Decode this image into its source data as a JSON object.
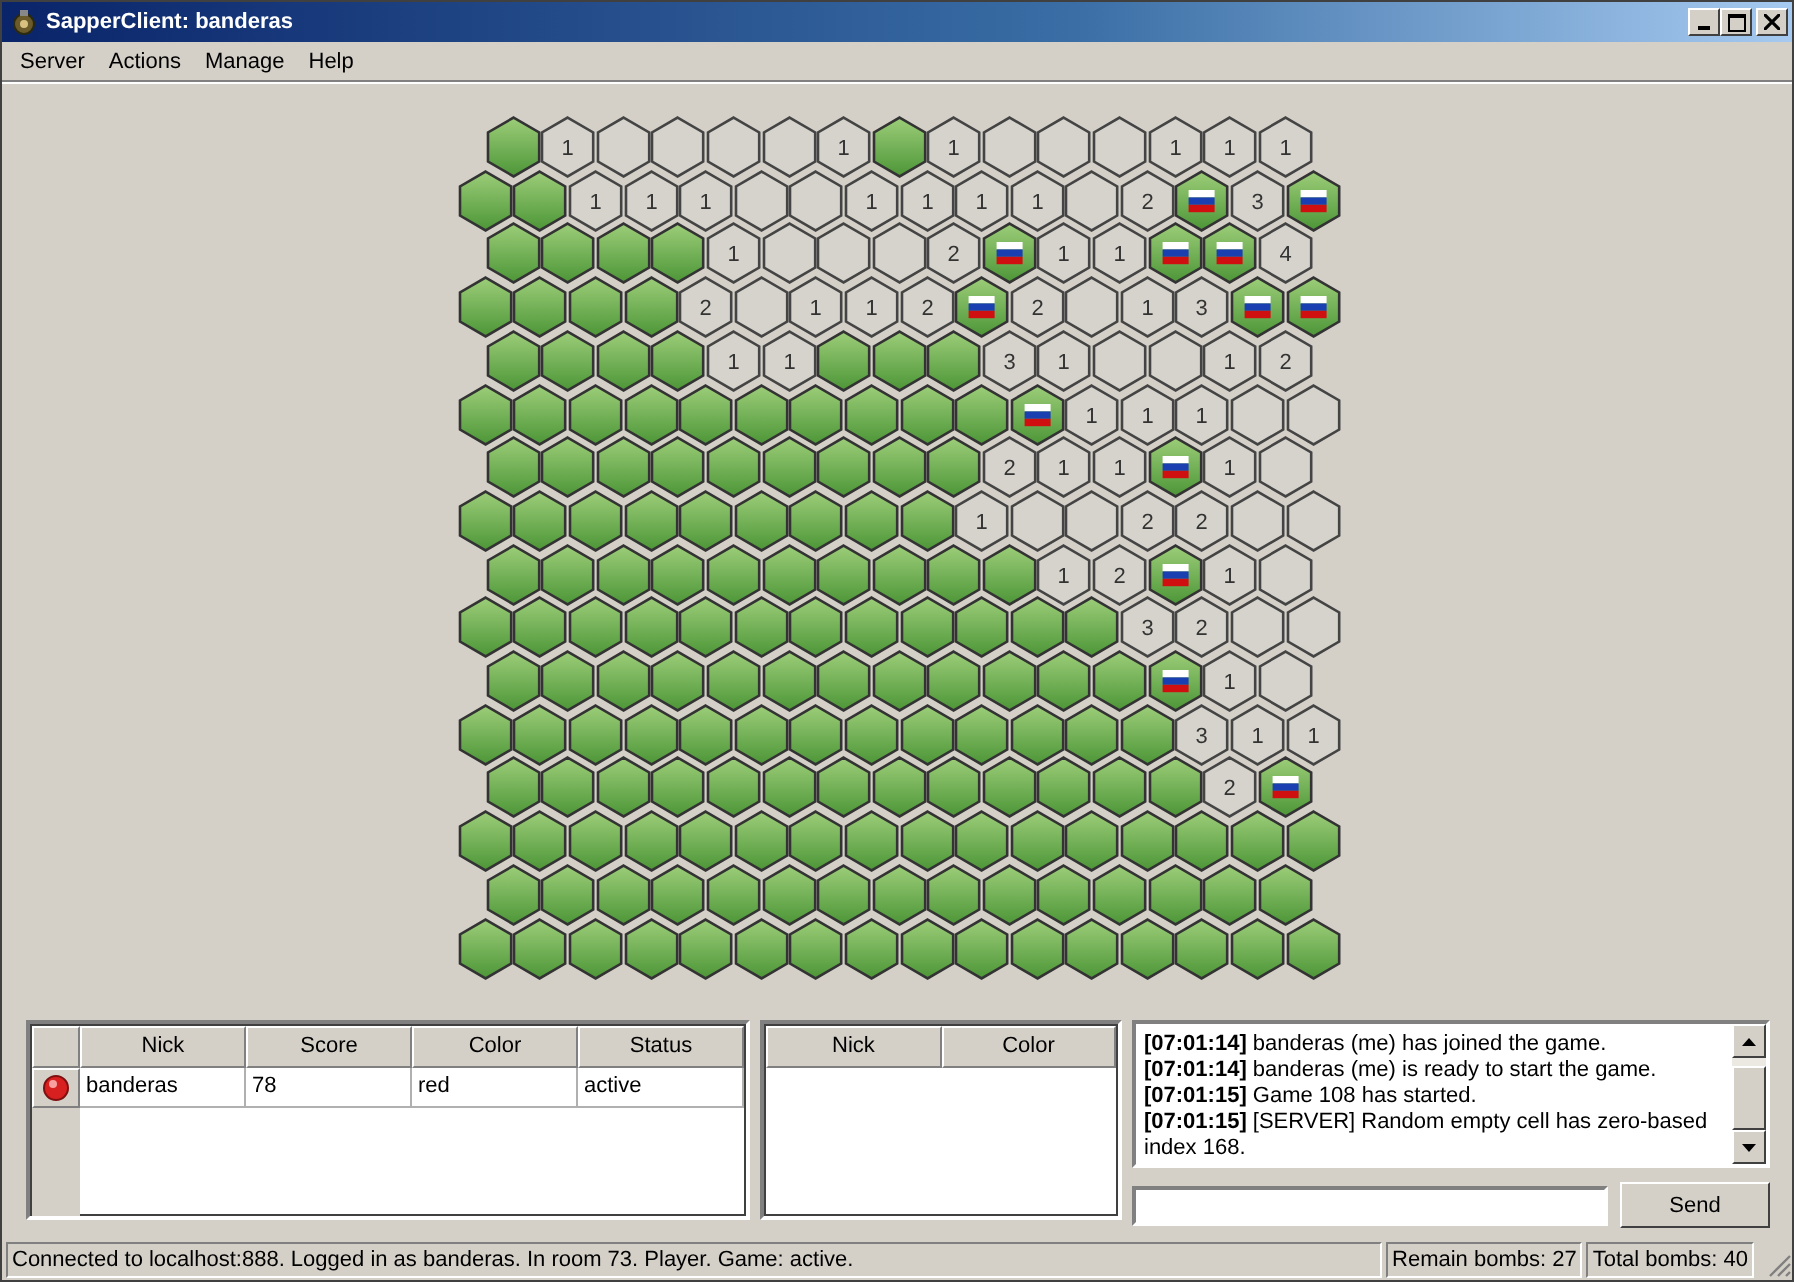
{
  "window": {
    "title": "SapperClient: banderas"
  },
  "menu": [
    "Server",
    "Actions",
    "Manage",
    "Help"
  ],
  "board": {
    "rows": [
      {
        "cells": [
          {
            "kind": "covered"
          },
          {
            "kind": "open",
            "count": "1"
          },
          {
            "kind": "open"
          },
          {
            "kind": "open"
          },
          {
            "kind": "open"
          },
          {
            "kind": "open"
          },
          {
            "kind": "open",
            "count": "1"
          },
          {
            "kind": "covered"
          },
          {
            "kind": "open",
            "count": "1"
          },
          {
            "kind": "open"
          },
          {
            "kind": "open"
          },
          {
            "kind": "open"
          },
          {
            "kind": "open",
            "count": "1"
          },
          {
            "kind": "open",
            "count": "1"
          },
          {
            "kind": "open",
            "count": "1"
          }
        ]
      },
      {
        "cells": [
          {
            "kind": "covered"
          },
          {
            "kind": "covered"
          },
          {
            "kind": "open",
            "count": "1"
          },
          {
            "kind": "open",
            "count": "1"
          },
          {
            "kind": "open",
            "count": "1"
          },
          {
            "kind": "open"
          },
          {
            "kind": "open"
          },
          {
            "kind": "open",
            "count": "1"
          },
          {
            "kind": "open",
            "count": "1"
          },
          {
            "kind": "open",
            "count": "1"
          },
          {
            "kind": "open",
            "count": "1"
          },
          {
            "kind": "open"
          },
          {
            "kind": "open",
            "count": "2"
          },
          {
            "kind": "flagged"
          },
          {
            "kind": "open",
            "count": "3"
          },
          {
            "kind": "flagged"
          }
        ]
      },
      {
        "cells": [
          {
            "kind": "covered"
          },
          {
            "kind": "covered"
          },
          {
            "kind": "covered"
          },
          {
            "kind": "covered"
          },
          {
            "kind": "open",
            "count": "1"
          },
          {
            "kind": "open"
          },
          {
            "kind": "open"
          },
          {
            "kind": "open"
          },
          {
            "kind": "open",
            "count": "2"
          },
          {
            "kind": "flagged"
          },
          {
            "kind": "open",
            "count": "1"
          },
          {
            "kind": "open",
            "count": "1"
          },
          {
            "kind": "flagged"
          },
          {
            "kind": "flagged"
          },
          {
            "kind": "open",
            "count": "4"
          }
        ]
      },
      {
        "cells": [
          {
            "kind": "covered"
          },
          {
            "kind": "covered"
          },
          {
            "kind": "covered"
          },
          {
            "kind": "covered"
          },
          {
            "kind": "open",
            "count": "2"
          },
          {
            "kind": "open"
          },
          {
            "kind": "open",
            "count": "1"
          },
          {
            "kind": "open",
            "count": "1"
          },
          {
            "kind": "open",
            "count": "2"
          },
          {
            "kind": "flagged"
          },
          {
            "kind": "open",
            "count": "2"
          },
          {
            "kind": "open"
          },
          {
            "kind": "open",
            "count": "1"
          },
          {
            "kind": "open",
            "count": "3"
          },
          {
            "kind": "flagged"
          },
          {
            "kind": "flagged"
          }
        ]
      },
      {
        "cells": [
          {
            "kind": "covered"
          },
          {
            "kind": "covered"
          },
          {
            "kind": "covered"
          },
          {
            "kind": "covered"
          },
          {
            "kind": "open",
            "count": "1"
          },
          {
            "kind": "open",
            "count": "1"
          },
          {
            "kind": "covered"
          },
          {
            "kind": "covered"
          },
          {
            "kind": "covered"
          },
          {
            "kind": "open",
            "count": "3"
          },
          {
            "kind": "open",
            "count": "1"
          },
          {
            "kind": "open"
          },
          {
            "kind": "open"
          },
          {
            "kind": "open",
            "count": "1"
          },
          {
            "kind": "open",
            "count": "2"
          }
        ]
      },
      {
        "cells": [
          {
            "kind": "covered"
          },
          {
            "kind": "covered"
          },
          {
            "kind": "covered"
          },
          {
            "kind": "covered"
          },
          {
            "kind": "covered"
          },
          {
            "kind": "covered"
          },
          {
            "kind": "covered"
          },
          {
            "kind": "covered"
          },
          {
            "kind": "covered"
          },
          {
            "kind": "covered"
          },
          {
            "kind": "flagged"
          },
          {
            "kind": "open",
            "count": "1"
          },
          {
            "kind": "open",
            "count": "1"
          },
          {
            "kind": "open",
            "count": "1"
          },
          {
            "kind": "open"
          },
          {
            "kind": "open"
          }
        ]
      },
      {
        "cells": [
          {
            "kind": "covered"
          },
          {
            "kind": "covered"
          },
          {
            "kind": "covered"
          },
          {
            "kind": "covered"
          },
          {
            "kind": "covered"
          },
          {
            "kind": "covered"
          },
          {
            "kind": "covered"
          },
          {
            "kind": "covered"
          },
          {
            "kind": "covered"
          },
          {
            "kind": "open",
            "count": "2"
          },
          {
            "kind": "open",
            "count": "1"
          },
          {
            "kind": "open",
            "count": "1"
          },
          {
            "kind": "flagged"
          },
          {
            "kind": "open",
            "count": "1"
          },
          {
            "kind": "open"
          }
        ]
      },
      {
        "cells": [
          {
            "kind": "covered"
          },
          {
            "kind": "covered"
          },
          {
            "kind": "covered"
          },
          {
            "kind": "covered"
          },
          {
            "kind": "covered"
          },
          {
            "kind": "covered"
          },
          {
            "kind": "covered"
          },
          {
            "kind": "covered"
          },
          {
            "kind": "covered"
          },
          {
            "kind": "open",
            "count": "1"
          },
          {
            "kind": "open"
          },
          {
            "kind": "open"
          },
          {
            "kind": "open",
            "count": "2"
          },
          {
            "kind": "open",
            "count": "2"
          },
          {
            "kind": "open"
          },
          {
            "kind": "open"
          }
        ]
      },
      {
        "cells": [
          {
            "kind": "covered"
          },
          {
            "kind": "covered"
          },
          {
            "kind": "covered"
          },
          {
            "kind": "covered"
          },
          {
            "kind": "covered"
          },
          {
            "kind": "covered"
          },
          {
            "kind": "covered"
          },
          {
            "kind": "covered"
          },
          {
            "kind": "covered"
          },
          {
            "kind": "covered"
          },
          {
            "kind": "open",
            "count": "1"
          },
          {
            "kind": "open",
            "count": "2"
          },
          {
            "kind": "flagged"
          },
          {
            "kind": "open",
            "count": "1"
          },
          {
            "kind": "open"
          }
        ]
      },
      {
        "cells": [
          {
            "kind": "covered"
          },
          {
            "kind": "covered"
          },
          {
            "kind": "covered"
          },
          {
            "kind": "covered"
          },
          {
            "kind": "covered"
          },
          {
            "kind": "covered"
          },
          {
            "kind": "covered"
          },
          {
            "kind": "covered"
          },
          {
            "kind": "covered"
          },
          {
            "kind": "covered"
          },
          {
            "kind": "covered"
          },
          {
            "kind": "covered"
          },
          {
            "kind": "open",
            "count": "3"
          },
          {
            "kind": "open",
            "count": "2"
          },
          {
            "kind": "open"
          },
          {
            "kind": "open"
          }
        ]
      },
      {
        "cells": [
          {
            "kind": "covered"
          },
          {
            "kind": "covered"
          },
          {
            "kind": "covered"
          },
          {
            "kind": "covered"
          },
          {
            "kind": "covered"
          },
          {
            "kind": "covered"
          },
          {
            "kind": "covered"
          },
          {
            "kind": "covered"
          },
          {
            "kind": "covered"
          },
          {
            "kind": "covered"
          },
          {
            "kind": "covered"
          },
          {
            "kind": "covered"
          },
          {
            "kind": "flagged"
          },
          {
            "kind": "open",
            "count": "1"
          },
          {
            "kind": "open"
          }
        ]
      },
      {
        "cells": [
          {
            "kind": "covered"
          },
          {
            "kind": "covered"
          },
          {
            "kind": "covered"
          },
          {
            "kind": "covered"
          },
          {
            "kind": "covered"
          },
          {
            "kind": "covered"
          },
          {
            "kind": "covered"
          },
          {
            "kind": "covered"
          },
          {
            "kind": "covered"
          },
          {
            "kind": "covered"
          },
          {
            "kind": "covered"
          },
          {
            "kind": "covered"
          },
          {
            "kind": "covered"
          },
          {
            "kind": "open",
            "count": "3"
          },
          {
            "kind": "open",
            "count": "1"
          },
          {
            "kind": "open",
            "count": "1"
          }
        ]
      },
      {
        "cells": [
          {
            "kind": "covered"
          },
          {
            "kind": "covered"
          },
          {
            "kind": "covered"
          },
          {
            "kind": "covered"
          },
          {
            "kind": "covered"
          },
          {
            "kind": "covered"
          },
          {
            "kind": "covered"
          },
          {
            "kind": "covered"
          },
          {
            "kind": "covered"
          },
          {
            "kind": "covered"
          },
          {
            "kind": "covered"
          },
          {
            "kind": "covered"
          },
          {
            "kind": "covered"
          },
          {
            "kind": "open",
            "count": "2"
          },
          {
            "kind": "flagged"
          }
        ]
      },
      {
        "cells": [
          {
            "kind": "covered"
          },
          {
            "kind": "covered"
          },
          {
            "kind": "covered"
          },
          {
            "kind": "covered"
          },
          {
            "kind": "covered"
          },
          {
            "kind": "covered"
          },
          {
            "kind": "covered"
          },
          {
            "kind": "covered"
          },
          {
            "kind": "covered"
          },
          {
            "kind": "covered"
          },
          {
            "kind": "covered"
          },
          {
            "kind": "covered"
          },
          {
            "kind": "covered"
          },
          {
            "kind": "covered"
          },
          {
            "kind": "covered"
          },
          {
            "kind": "covered"
          }
        ]
      },
      {
        "cells": [
          {
            "kind": "covered"
          },
          {
            "kind": "covered"
          },
          {
            "kind": "covered"
          },
          {
            "kind": "covered"
          },
          {
            "kind": "covered"
          },
          {
            "kind": "covered"
          },
          {
            "kind": "covered"
          },
          {
            "kind": "covered"
          },
          {
            "kind": "covered"
          },
          {
            "kind": "covered"
          },
          {
            "kind": "covered"
          },
          {
            "kind": "covered"
          },
          {
            "kind": "covered"
          },
          {
            "kind": "covered"
          },
          {
            "kind": "covered"
          }
        ]
      },
      {
        "cells": [
          {
            "kind": "covered"
          },
          {
            "kind": "covered"
          },
          {
            "kind": "covered"
          },
          {
            "kind": "covered"
          },
          {
            "kind": "covered"
          },
          {
            "kind": "covered"
          },
          {
            "kind": "covered"
          },
          {
            "kind": "covered"
          },
          {
            "kind": "covered"
          },
          {
            "kind": "covered"
          },
          {
            "kind": "covered"
          },
          {
            "kind": "covered"
          },
          {
            "kind": "covered"
          },
          {
            "kind": "covered"
          },
          {
            "kind": "covered"
          },
          {
            "kind": "covered"
          }
        ]
      }
    ]
  },
  "players_table": {
    "columns": [
      "Nick",
      "Score",
      "Color",
      "Status"
    ],
    "rows": [
      {
        "cells": [
          "banderas",
          "78",
          "red",
          "active"
        ]
      }
    ]
  },
  "spectators_table": {
    "columns": [
      "Nick",
      "Color"
    ]
  },
  "chat": {
    "messages": [
      {
        "time": "[07:01:14]",
        "text": "banderas (me) has joined the game."
      },
      {
        "time": "[07:01:14]",
        "text": "banderas (me) is ready to start the game."
      },
      {
        "time": "[07:01:15]",
        "text": "Game 108 has started."
      },
      {
        "time": "[07:01:15]",
        "text": "[SERVER] Random empty cell has zero-based index 168."
      }
    ],
    "send_button": "Send"
  },
  "status_bar": {
    "message": "Connected to localhost:888. Logged in as banderas. In room 73. Player. Game: active.",
    "remain_bombs": "Remain bombs: 27",
    "total_bombs": "Total bombs: 40"
  }
}
